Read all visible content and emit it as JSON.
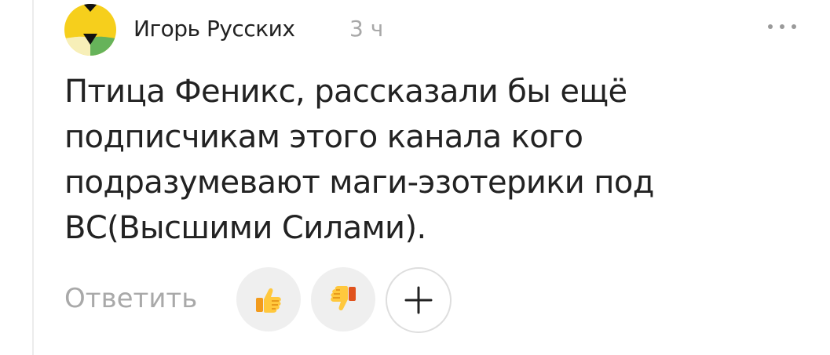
{
  "comment": {
    "author": "Игорь Русских",
    "time": "3 ч",
    "text": "Птица Феникс, рассказали бы ещё\nподписчикам этого канала кого\nподразумевают маги-эзотерики под\nВС(Высшими Силами)."
  },
  "actions": {
    "reply_label": "Ответить",
    "like_icon": "thumbs-up-emoji",
    "dislike_icon": "thumbs-down-emoji",
    "add_icon": "plus-icon",
    "more_icon": "more-dots-icon"
  },
  "colors": {
    "text": "#222222",
    "muted": "#a9a9a9",
    "button_bg": "#efefef",
    "avatar_yellow": "#f6cf1c",
    "avatar_green": "#66b35a",
    "avatar_cream": "#f7efb8"
  }
}
